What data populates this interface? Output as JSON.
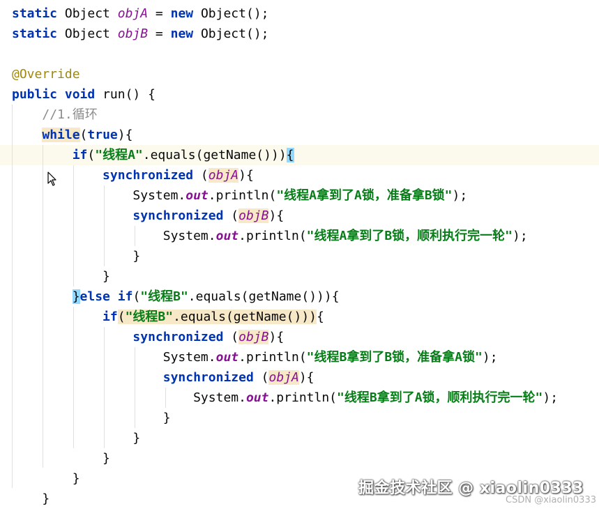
{
  "editor": {
    "lines": [
      {
        "tokens": [
          {
            "t": "static",
            "c": "kw"
          },
          {
            "t": " Object ",
            "c": "plain"
          },
          {
            "t": "objA",
            "c": "field"
          },
          {
            "t": " = ",
            "c": "plain"
          },
          {
            "t": "new",
            "c": "kw"
          },
          {
            "t": " Object();",
            "c": "plain"
          }
        ]
      },
      {
        "tokens": [
          {
            "t": "static",
            "c": "kw"
          },
          {
            "t": " Object ",
            "c": "plain"
          },
          {
            "t": "objB",
            "c": "field"
          },
          {
            "t": " = ",
            "c": "plain"
          },
          {
            "t": "new",
            "c": "kw"
          },
          {
            "t": " Object();",
            "c": "plain"
          }
        ]
      },
      {
        "tokens": []
      },
      {
        "tokens": [
          {
            "t": "@Override",
            "c": "annotation"
          }
        ]
      },
      {
        "tokens": [
          {
            "t": "public",
            "c": "kw"
          },
          {
            "t": " ",
            "c": "plain"
          },
          {
            "t": "void",
            "c": "kw"
          },
          {
            "t": " run() {",
            "c": "plain"
          }
        ]
      },
      {
        "tokens": [
          {
            "t": "    ",
            "c": "plain"
          },
          {
            "t": "//1.循环",
            "c": "comment"
          }
        ]
      },
      {
        "tokens": [
          {
            "t": "    ",
            "c": "plain"
          },
          {
            "t": "while",
            "c": "kw hl-read"
          },
          {
            "t": "(",
            "c": "plain"
          },
          {
            "t": "true",
            "c": "kw"
          },
          {
            "t": "){",
            "c": "plain"
          }
        ]
      },
      {
        "current": true,
        "tokens": [
          {
            "t": "        ",
            "c": "plain"
          },
          {
            "t": "if",
            "c": "kw"
          },
          {
            "t": "(",
            "c": "plain"
          },
          {
            "t": "\"线程A\"",
            "c": "str"
          },
          {
            "t": ".equals(getName()))",
            "c": "plain"
          },
          {
            "t": "{",
            "c": "plain hl-brace"
          }
        ]
      },
      {
        "tokens": [
          {
            "t": "            ",
            "c": "plain"
          },
          {
            "t": "synchronized",
            "c": "kw"
          },
          {
            "t": " (",
            "c": "plain"
          },
          {
            "t": "objA",
            "c": "field hl-read"
          },
          {
            "t": "){",
            "c": "plain"
          }
        ]
      },
      {
        "tokens": [
          {
            "t": "                ",
            "c": "plain"
          },
          {
            "t": "System.",
            "c": "plain"
          },
          {
            "t": "out",
            "c": "static-field"
          },
          {
            "t": ".println(",
            "c": "plain"
          },
          {
            "t": "\"线程A拿到了A锁，准备拿B锁\"",
            "c": "str"
          },
          {
            "t": ");",
            "c": "plain"
          }
        ]
      },
      {
        "tokens": [
          {
            "t": "                ",
            "c": "plain"
          },
          {
            "t": "synchronized",
            "c": "kw"
          },
          {
            "t": " (",
            "c": "plain"
          },
          {
            "t": "objB",
            "c": "field hl-read"
          },
          {
            "t": "){",
            "c": "plain"
          }
        ]
      },
      {
        "tokens": [
          {
            "t": "                    ",
            "c": "plain"
          },
          {
            "t": "System.",
            "c": "plain"
          },
          {
            "t": "out",
            "c": "static-field"
          },
          {
            "t": ".println(",
            "c": "plain"
          },
          {
            "t": "\"线程A拿到了B锁，顺利执行完一轮\"",
            "c": "str"
          },
          {
            "t": ");",
            "c": "plain"
          }
        ]
      },
      {
        "tokens": [
          {
            "t": "                }",
            "c": "plain"
          }
        ]
      },
      {
        "tokens": [
          {
            "t": "            }",
            "c": "plain"
          }
        ]
      },
      {
        "tokens": [
          {
            "t": "        ",
            "c": "plain"
          },
          {
            "t": "}",
            "c": "plain hl-brace"
          },
          {
            "t": "else",
            "c": "kw"
          },
          {
            "t": " ",
            "c": "plain"
          },
          {
            "t": "if",
            "c": "kw"
          },
          {
            "t": "(",
            "c": "plain"
          },
          {
            "t": "\"线程B\"",
            "c": "str"
          },
          {
            "t": ".equals(getName())){",
            "c": "plain"
          }
        ]
      },
      {
        "tokens": [
          {
            "t": "            ",
            "c": "plain"
          },
          {
            "t": "if",
            "c": "kw"
          },
          {
            "t": "(",
            "c": "plain hl-paren"
          },
          {
            "t": "\"线程B\"",
            "c": "str hl-paren"
          },
          {
            "t": ".equals(getName())",
            "c": "plain hl-paren"
          },
          {
            "t": ")",
            "c": "plain hl-paren"
          },
          {
            "t": "{",
            "c": "plain"
          }
        ]
      },
      {
        "tokens": [
          {
            "t": "                ",
            "c": "plain"
          },
          {
            "t": "synchronized",
            "c": "kw"
          },
          {
            "t": " (",
            "c": "plain"
          },
          {
            "t": "objB",
            "c": "field hl-read"
          },
          {
            "t": "){",
            "c": "plain"
          }
        ]
      },
      {
        "tokens": [
          {
            "t": "                    ",
            "c": "plain"
          },
          {
            "t": "System.",
            "c": "plain"
          },
          {
            "t": "out",
            "c": "static-field"
          },
          {
            "t": ".println(",
            "c": "plain"
          },
          {
            "t": "\"线程B拿到了B锁，准备拿A锁\"",
            "c": "str"
          },
          {
            "t": ");",
            "c": "plain"
          }
        ]
      },
      {
        "tokens": [
          {
            "t": "                    ",
            "c": "plain"
          },
          {
            "t": "synchronized",
            "c": "kw"
          },
          {
            "t": " (",
            "c": "plain"
          },
          {
            "t": "objA",
            "c": "field hl-read"
          },
          {
            "t": "){",
            "c": "plain"
          }
        ]
      },
      {
        "tokens": [
          {
            "t": "                        ",
            "c": "plain"
          },
          {
            "t": "System.",
            "c": "plain"
          },
          {
            "t": "out",
            "c": "static-field"
          },
          {
            "t": ".println(",
            "c": "plain"
          },
          {
            "t": "\"线程B拿到了A锁，顺利执行完一轮\"",
            "c": "str"
          },
          {
            "t": ");",
            "c": "plain"
          }
        ]
      },
      {
        "tokens": [
          {
            "t": "                    }",
            "c": "plain"
          }
        ]
      },
      {
        "tokens": [
          {
            "t": "                }",
            "c": "plain"
          }
        ]
      },
      {
        "tokens": [
          {
            "t": "            }",
            "c": "plain"
          }
        ]
      },
      {
        "tokens": [
          {
            "t": "        }",
            "c": "plain"
          }
        ]
      },
      {
        "tokens": [
          {
            "t": "    }",
            "c": "plain"
          }
        ]
      },
      {
        "tokens": [
          {
            "t": "}",
            "c": "plain"
          }
        ]
      }
    ]
  },
  "watermark": {
    "main": "掘金技术社区 @ xiaolin0333",
    "csdn": "CSDN @xiaolin0333"
  },
  "icons": {
    "cursor": "mouse-pointer-icon"
  }
}
